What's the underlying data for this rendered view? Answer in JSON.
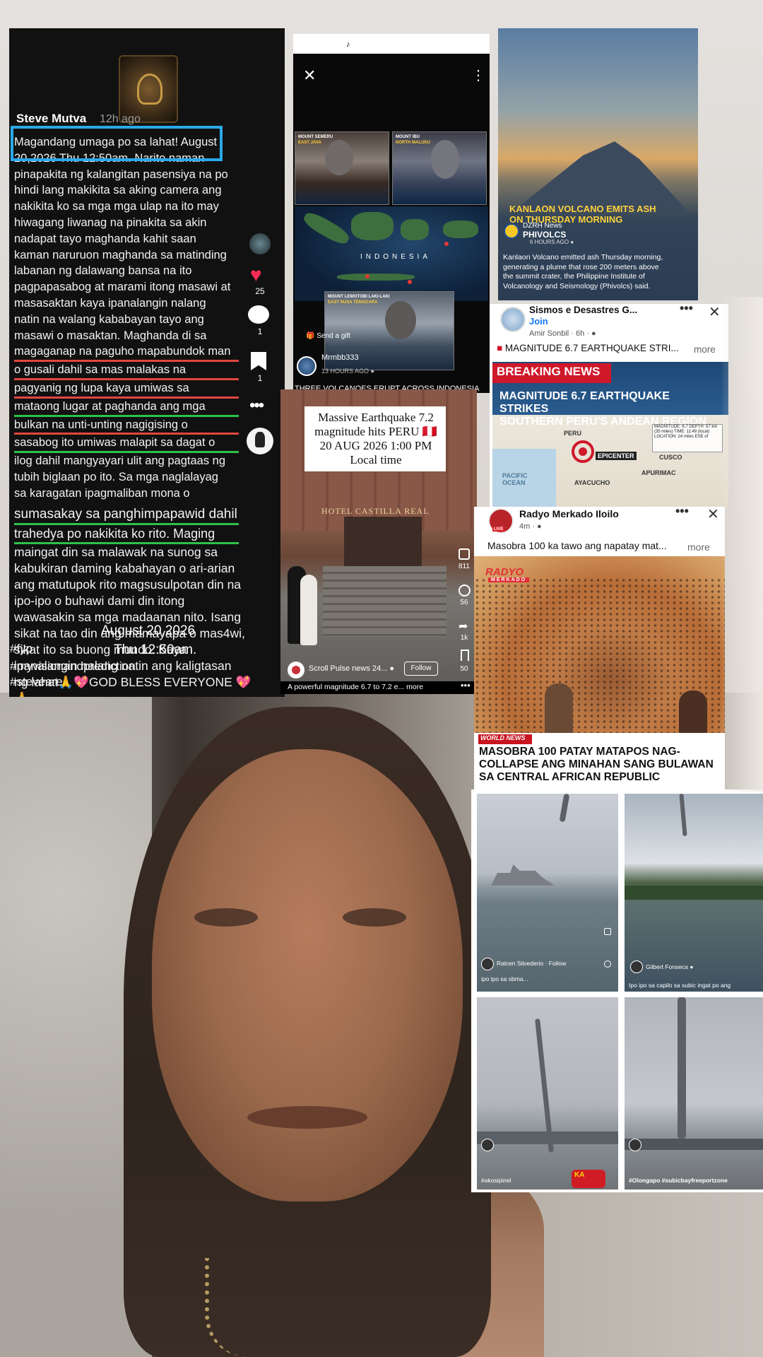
{
  "post": {
    "username": "Steve Mutva",
    "time": "12h ago",
    "body_lines": [
      "Magandang umaga po sa lahat! August",
      "20,2026 Thu 12:50am. Narito naman",
      "pinapakita ng kalangitan pasensiya na po",
      "hindi lang makikita sa aking camera ang",
      "nakikita ko sa mga mga ulap na ito may",
      "hiwagang liwanag na pinakita sa akin",
      "nadapat tayo maghanda kahit saan",
      "kaman naruruon maghanda sa matinding",
      "labanan ng dalawang bansa na ito",
      "pagpapasabog at marami itong masawi at",
      "masasaktan kaya ipanalangin nalang",
      "natin na walang kababayan tayo ang",
      "masawi o masaktan. Maghanda di sa",
      "magaganap na paguho mapabundok man",
      "o gusali dahil sa mas malakas na",
      "pagyanig ng lupa kaya umiwas sa",
      "mataong lugar at paghanda ang mga",
      "bulkan na unti-unting nagigising o",
      "sasabog ito umiwas malapit sa dagat o",
      "ilog dahil mangyayari ulit ang pagtaas ng",
      "tubih biglaan po ito. Sa mga naglalayag",
      "sa karagatan ipagmaliban mona o"
    ],
    "body_lines_big": [
      "sumasakay sa panghimpapawid dahil",
      "trahedya po nakikita ko rito. Maging",
      "maingat din sa malawak na sunog sa",
      "kabukiran daming kabahayan o ari-arian",
      "ang matutupok rito magsusulpotan din na",
      "ipo-ipo o buhawi dami din itong",
      "wawasakin sa mga madaanan nito. Isang",
      "sikat na tao din ang mamayapa o mas4wi,",
      "sikat ito sa buong mundo. Kaya",
      "ipanalangin nalang natin ang kaligtasan",
      "ng lahat🙏💖GOD BLESS EVERYONE 💖",
      "🙏"
    ],
    "date_overlay_a": "August 20,2026",
    "date_overlay_b": "Thu 12:50am.",
    "tag_fyp": "#fyp",
    "tag_vision": "#myvisionandprediction",
    "tag_steve": "#steveare",
    "likes": "25",
    "comments": "1",
    "saves": "1",
    "heart_icon": "♥",
    "more_icon": "•••"
  },
  "indonesia_video": {
    "close_icon": "✕",
    "menu_icon": "⋮",
    "tiktok_mark": "♪",
    "panel_a_title": "MOUNT SEMERU",
    "panel_a_sub": "EAST JAVA",
    "panel_b_title": "MOUNT IBU",
    "panel_b_sub": "NORTH MALUKU",
    "panel_c_title": "MOUNT LEWOTOBI LAKI-LAKI",
    "panel_c_sub": "EAST NUSA TENGGARA",
    "map_label": "INDONESIA",
    "send_gift": "🎁 Send a gift",
    "username": "Mrmbb333",
    "ago": "13 HOURS AGO ●",
    "caption": "THREE VOLCANOES ERUPT ACROSS INDONESIA"
  },
  "kanlaon": {
    "title_line1": "KANLAON VOLCANO EMITS ASH",
    "title_line2": "ON THURSDAY MORNING",
    "news_label": "DZRH News",
    "org": "PHIVOLCS",
    "ago": "6 HOURS AGO ●",
    "body_lines": [
      "Kanlaon Volcano emitted ash Thursday morning,",
      "generating a plume that rose 200 meters above",
      "the summit crater, the Philippine Institute of",
      "Volcanology and Seismology (Phivolcs) said."
    ]
  },
  "sismos": {
    "group": "Sismos e Desastres G...",
    "join": "Join",
    "author": "Amir Sonbil · 6h · ●",
    "dots": "•••",
    "close": "✕",
    "preview_icon": "■",
    "preview": "MAGNITUDE 6.7 EARTHQUAKE STRI...",
    "more": "more",
    "breaking": "BREAKING NEWS",
    "headline_1": "MAGNITUDE 6.7 EARTHQUAKE STRIKES",
    "headline_2": "SOUTHERN PERU'S ANDEAN REGION",
    "map_peru": "PERU",
    "map_cusco": "CUSCO",
    "map_apurimac": "APURIMAC",
    "map_ayacucho": "AYACUCHO",
    "map_ocean": "PACIFIC OCEAN",
    "map_epicenter": "EPICENTER",
    "info": "MAGNITUDE: 6.7 DEPTH: 57 km (35 miles) TIME: 11:49 (local) LOCATION: 24 miles ESE of",
    "accent_red": "#d0182b"
  },
  "peru_video": {
    "caption_1": "Massive Earthquake 7.2",
    "caption_2": "magnitude hits PERU 🇵🇪",
    "caption_3": "20 AUG 2026 1:00 PM",
    "caption_4": "Local time",
    "hotel_sign": "HOTEL CASTILLA REAL",
    "likes": "811",
    "comments": "56",
    "shares": "1k",
    "saves": "50",
    "share_icon": "➦",
    "user": "Scroll Pulse news 24... ●",
    "follow": "Follow",
    "description": "A powerful magnitude 6.7 to 7.2 e... more",
    "dots": "•••"
  },
  "radyo": {
    "name": "Radyo Merkado Iloilo",
    "age": "4m · ●",
    "live": "LIVE",
    "dots": "•••",
    "close": "✕",
    "preview": "Masobra 100 ka tawo ang napatay mat...",
    "more": "more",
    "logo": "RADYO",
    "logo_sub": "MERKADO",
    "world_news": "WORLD NEWS",
    "headline_1": "MASOBRA 100 PATAY MATAPOS NAG-",
    "headline_2": "COLLAPSE ANG MINAHAN SANG BULAWAN",
    "headline_3": "SA CENTRAL AFRICAN REPUBLIC"
  },
  "waterspouts": {
    "a_user": "Ralcen Silvederio · Follow",
    "a_caption": "ipo ipo sa sbma...",
    "b_user": "Gilbert Fonseca ●",
    "b_caption": "Ipo ipo sa capilo sa subic ingat po ang",
    "c_tag": "#akosipinel",
    "d_tag": "#Olongapo #subicbayfreeportzone",
    "logo": "KA"
  }
}
